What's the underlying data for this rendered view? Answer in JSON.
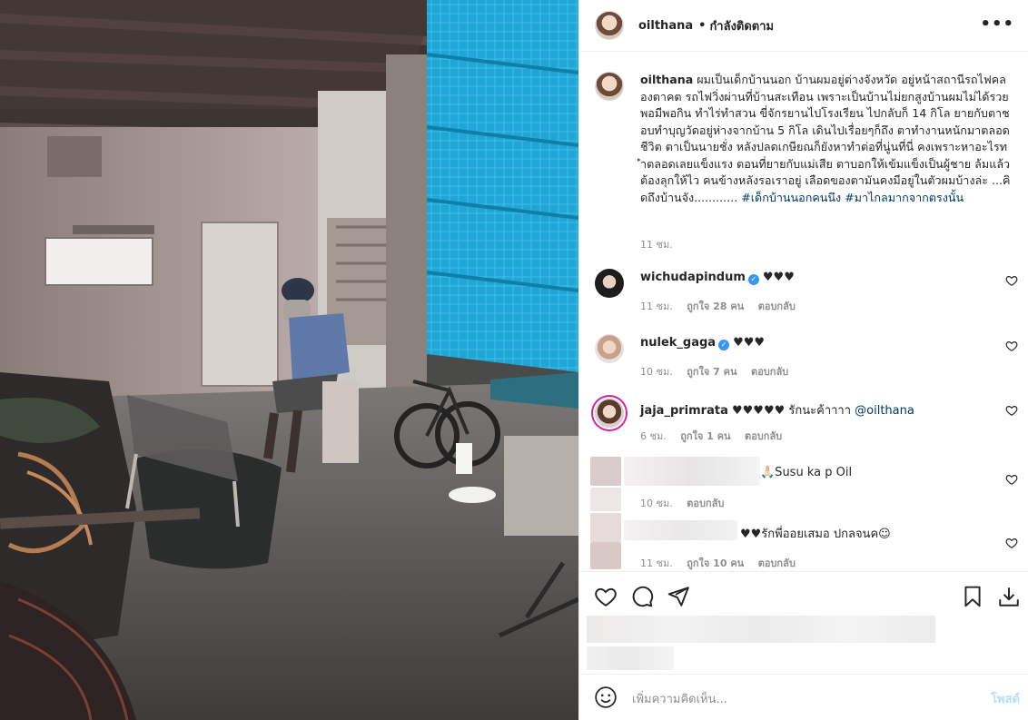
{
  "post": {
    "username": "oilthana",
    "separator": "•",
    "follow_label": "กำลังติดตาม",
    "more_icon": "more-horizontal-icon",
    "more_label": "•••"
  },
  "caption": {
    "username": "oilthana",
    "text": "ผมเป็นเด็กบ้านนอก บ้านผมอยู่ต่างจังหวัด อยู่หน้าสถานีรถไฟคลองตาคต รถไฟวิ่งผ่านที่บ้านสะเทือน เพราะเป็นบ้านไม่ยกสูงบ้านผมไม่ได้รวย พอมีพอกิน ทำไร่ทำสวน ขี่จักรยานไปโรงเรียน ไปกลับก็ 14 กิโล ยายกับตาชอบทำบุญวัดอยู่ห่างจากบ้าน 5 กิโล เดินไปเรื่อยๆก็ถึง ตาทำงานหนักมาตลอดชีวิต ตาเป็นนายชั่ง หลังปลดเกษียณก็ยังหาทำต่อที่นู่นที่นี่ คงเพราะหาอะไรทำตลอดเลยแข็งแรง ตอนที่ยายกับแม่เสีย ตาบอกให้เข้มแข็งเป็นผู้ชาย ล้มแล้วต้องลุกให้ไว คนข้างหลังรอเราอยู่ เลือดของตามันคงมีอยู่ในตัวผมบ้างล่ะ ...คิดถึงบ้านจัง............ ",
    "hashtags": "#เด็กบ้านนอกคนนึง #มาไกลมากจากตรงนั้น",
    "time": "11 ชม."
  },
  "comments": [
    {
      "username": "wichudapindum",
      "verified": true,
      "text": "♥♥♥",
      "time": "11 ชม.",
      "likes": "ถูกใจ 28 คน",
      "reply": "ตอบกลับ"
    },
    {
      "username": "nulek_gaga",
      "verified": true,
      "text": "♥♥♥",
      "time": "10 ชม.",
      "likes": "ถูกใจ 7 คน",
      "reply": "ตอบกลับ"
    },
    {
      "username": "jaja_primrata",
      "verified": false,
      "text": "♥♥♥♥♥ รักนะค้าาาา ",
      "mention": "@oilthana",
      "time": "6 ชม.",
      "likes": "ถูกใจ 1 คน",
      "reply": "ตอบกลับ"
    },
    {
      "text": "🙏🏻Susu ka p Oil",
      "time": "10 ชม.",
      "reply": "ตอบกลับ"
    },
    {
      "text": "♥♥รักพี่ออยเสมอ ปกลจนค☺",
      "time": "11 ชม.",
      "likes": "ถูกใจ 10 คน",
      "reply": "ตอบกลับ"
    }
  ],
  "actions": {
    "like_icon": "heart-icon",
    "comment_icon": "comment-icon",
    "share_icon": "send-icon",
    "save_icon": "bookmark-icon",
    "download_icon": "download-icon"
  },
  "add_comment": {
    "placeholder": "เพิ่มความคิดเห็น...",
    "post_label": "โพสต์",
    "emoji_icon": "smiley-icon"
  },
  "colors": {
    "link": "#00376b",
    "verified": "#3897f0",
    "muted": "#8e8e8e",
    "post_disabled": "#b2dffc",
    "net_blue": "#1ea6d6"
  }
}
